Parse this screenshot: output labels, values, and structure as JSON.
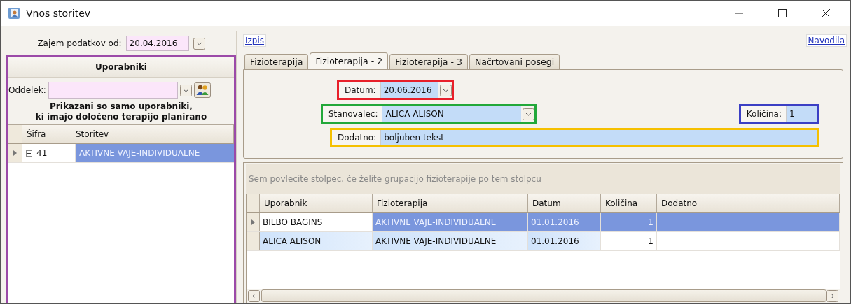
{
  "window": {
    "title": "Vnos storitev"
  },
  "left": {
    "date_label": "Zajem podatkov od:",
    "date_value": "20.04.2016",
    "panel_title": "Uporabniki",
    "department_label": "Oddelek:",
    "notice_lines": [
      "Prikazani so samo uporabniki,",
      "ki imajo določeno terapijo planirano"
    ],
    "table": {
      "columns": [
        "Šifra",
        "Storitev"
      ],
      "rows": [
        {
          "code": "41",
          "service": "AKTIVNE VAJE-INDIVIDUALNE",
          "selected": true,
          "expanded": false
        }
      ]
    }
  },
  "right": {
    "print_link": "Izpis",
    "help_link": "Navodila",
    "tabs": [
      {
        "label": "Fizioterapija",
        "selected": false
      },
      {
        "label": "Fizioterapija - 2",
        "selected": true
      },
      {
        "label": "Fizioterapija - 3",
        "selected": false
      },
      {
        "label": "Načrtovani posegi",
        "selected": false
      }
    ],
    "datum": {
      "label": "Datum:",
      "value": "20.06.2016",
      "color": "#e8202a"
    },
    "stanovalec": {
      "label": "Stanovalec:",
      "value": "ALICA ALISON",
      "color": "#22a83a"
    },
    "kolicina": {
      "label": "Količina:",
      "value": "1",
      "color": "#3b3fc4"
    },
    "dodatno": {
      "label": "Dodatno:",
      "value": "boljuben tekst",
      "color": "#f5c000"
    },
    "grid": {
      "group_hint": "Sem povlecite stolpec, če želite grupacijo fizioterapije po tem stolpcu",
      "columns": [
        "Uporabnik",
        "Fizioterapija",
        "Datum",
        "Količina",
        "Dodatno"
      ],
      "rows": [
        {
          "cells": [
            "BILBO  BAGINS",
            "AKTIVNE VAJE-INDIVIDUALNE",
            "01.01.2016",
            "1",
            ""
          ],
          "selected": true
        },
        {
          "cells": [
            "ALICA ALISON",
            "AKTIVNE VAJE-INDIVIDUALNE",
            "01.01.2016",
            "1",
            ""
          ],
          "selected": false
        }
      ]
    }
  }
}
